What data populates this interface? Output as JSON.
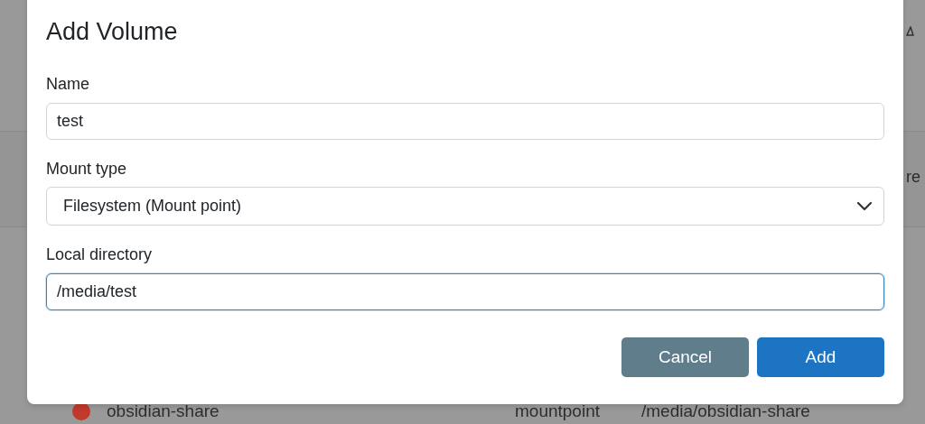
{
  "background": {
    "header_fragment": "re",
    "volumes": [
      {
        "name": "obsidian-share",
        "color": "#c0392b",
        "type": "mountpoint",
        "path": "/media/obsidian-share"
      }
    ]
  },
  "modal": {
    "title": "Add Volume",
    "fields": [
      {
        "kind": "text",
        "label": "Name",
        "value": "test",
        "focused": false
      },
      {
        "kind": "select",
        "label": "Mount type",
        "value": "Filesystem (Mount point)",
        "focused": false
      },
      {
        "kind": "text",
        "label": "Local directory",
        "value": "/media/test",
        "focused": true
      }
    ],
    "buttons": [
      {
        "kind": "secondary",
        "label": "Cancel"
      },
      {
        "kind": "primary",
        "label": "Add"
      }
    ]
  }
}
